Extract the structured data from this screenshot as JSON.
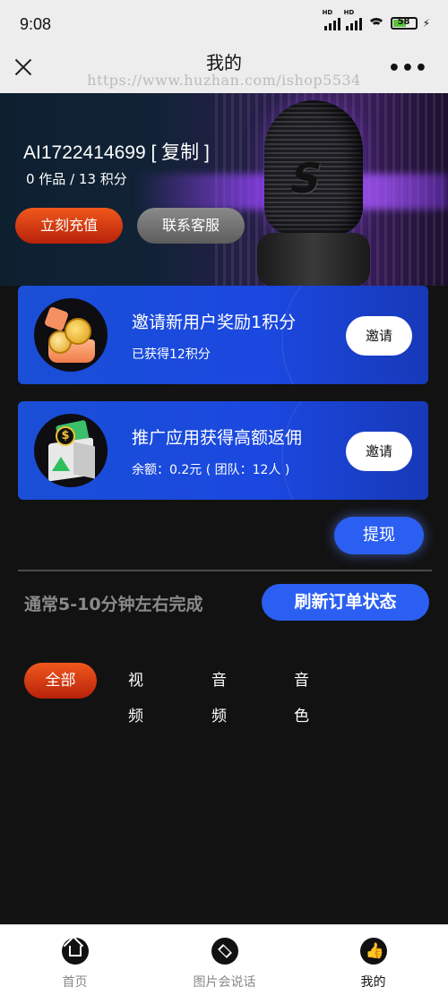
{
  "status_bar": {
    "time": "9:08",
    "battery": "58"
  },
  "title_bar": {
    "title": "我的",
    "watermark": "https://www.huzhan.com/ishop5534"
  },
  "profile": {
    "user_id_label": "AI1722414699 [ 复制 ]",
    "stats": "0 作品 / 13 积分",
    "recharge_label": "立刻充值",
    "service_label": "联系客服"
  },
  "cards": [
    {
      "title": "邀请新用户奖励1积分",
      "subtitle": "已获得12积分",
      "button": "邀请",
      "icon": "coins-gift-icon"
    },
    {
      "title": "推广应用获得高额返佣",
      "subtitle": "余额：0.2元 ( 团队：12人 )",
      "button": "邀请",
      "icon": "money-box-icon"
    }
  ],
  "withdraw_label": "提现",
  "orders": {
    "hint": "通常5-10分钟左右完成",
    "refresh_label": "刷新订单状态"
  },
  "filter_tabs": [
    "全部",
    "视频",
    "音频",
    "音色"
  ],
  "bottom_nav": [
    {
      "label": "首页",
      "icon": "home-icon"
    },
    {
      "label": "图片会说话",
      "icon": "layers-icon"
    },
    {
      "label": "我的",
      "icon": "thumbs-up-icon"
    }
  ],
  "colors": {
    "accent_orange": "#e04414",
    "accent_blue": "#2b5ff2",
    "card_blue": "#1b48e0",
    "background": "#121212"
  }
}
